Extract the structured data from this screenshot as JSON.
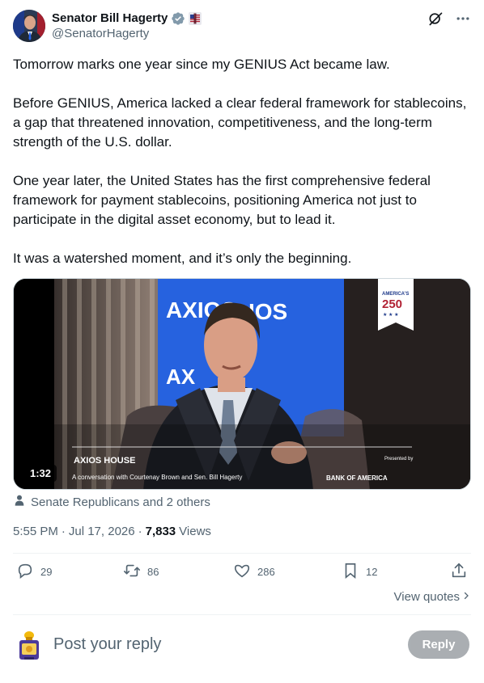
{
  "author": {
    "display_name": "Senator Bill Hagerty",
    "handle": "@SenatorHagerty",
    "verified_badge_color": "#829aab",
    "badges": [
      "verified-icon",
      "government-flag-icon"
    ]
  },
  "tweet": {
    "paragraphs": [
      "Tomorrow marks one year since my GENIUS Act became law.",
      "Before GENIUS, America lacked a clear federal framework for stablecoins, a gap that threatened innovation, competitiveness, and the long-term strength of the U.S. dollar.",
      "One year later, the United States has the first comprehensive federal framework for payment stablecoins, positioning America not just to participate in the digital asset economy, but to lead it.",
      "It was a watershed moment, and it’s only the beginning."
    ]
  },
  "media": {
    "type": "video",
    "duration": "1:32",
    "backdrop_text": "AXIOS",
    "lower_third_brand": "AXIOS HOUSE",
    "lower_third_caption": "A conversation with Courtenay Brown and Sen. Bill Hagerty",
    "presented_by": "Presented by",
    "sponsor": "BANK OF AMERICA",
    "corner_badge_top": "AMERICA’S",
    "corner_badge_number": "250",
    "corner_badge_stars": "★ ★ ★"
  },
  "tagged": "Senate Republicans and 2 others",
  "meta": {
    "time": "5:55 PM",
    "separator": "·",
    "date": "Jul 17, 2026",
    "views_count": "7,833",
    "views_label": "Views"
  },
  "actions": {
    "replies": "29",
    "reposts": "86",
    "likes": "286",
    "bookmarks": "12"
  },
  "view_quotes": "View quotes",
  "reply": {
    "placeholder": "Post your reply",
    "button": "Reply"
  }
}
